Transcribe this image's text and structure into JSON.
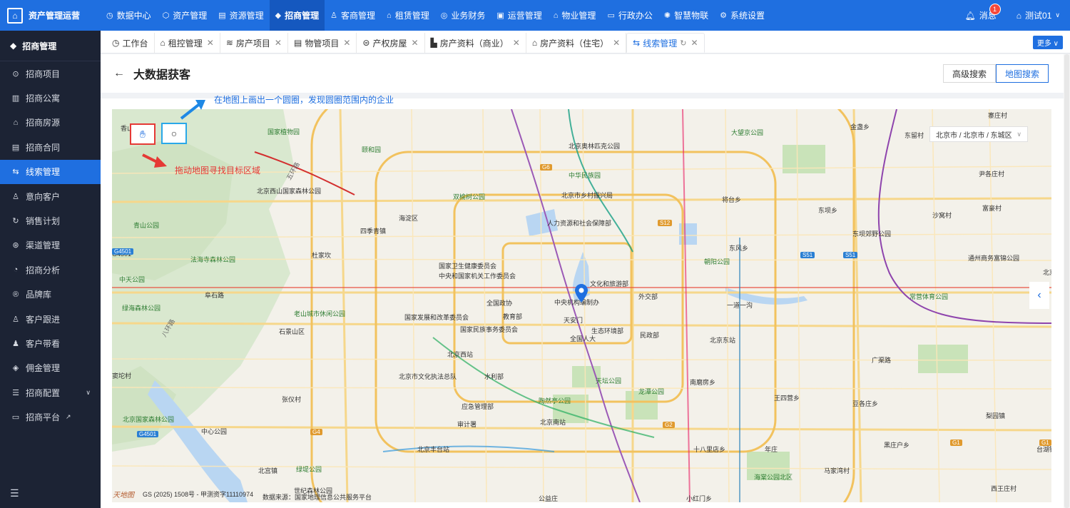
{
  "app": {
    "title": "资产管理运营"
  },
  "topnav": [
    {
      "label": "数据中心",
      "icon": "dashboard-icon",
      "glyph": "◷"
    },
    {
      "label": "资产管理",
      "icon": "cube-icon",
      "glyph": "⬡"
    },
    {
      "label": "资源管理",
      "icon": "building-icon",
      "glyph": "▤"
    },
    {
      "label": "招商管理",
      "icon": "diamond-icon",
      "glyph": "◆"
    },
    {
      "label": "客商管理",
      "icon": "user-group-icon",
      "glyph": "♙"
    },
    {
      "label": "租赁管理",
      "icon": "house-icon",
      "glyph": "⌂"
    },
    {
      "label": "业务财务",
      "icon": "coin-icon",
      "glyph": "◎"
    },
    {
      "label": "运营管理",
      "icon": "chart-icon",
      "glyph": "▣"
    },
    {
      "label": "物业管理",
      "icon": "home-icon",
      "glyph": "⌂"
    },
    {
      "label": "行政办公",
      "icon": "desktop-icon",
      "glyph": "▭"
    },
    {
      "label": "智慧物联",
      "icon": "iot-icon",
      "glyph": "✺"
    },
    {
      "label": "系统设置",
      "icon": "gear-icon",
      "glyph": "⚙"
    }
  ],
  "topright": {
    "messages_label": "消息",
    "messages_count": "1",
    "user_label": "测试01"
  },
  "sidebar": {
    "header": "招商管理",
    "items": [
      {
        "label": "招商项目",
        "glyph": "⊙"
      },
      {
        "label": "招商公寓",
        "glyph": "▥"
      },
      {
        "label": "招商房源",
        "glyph": "⌂"
      },
      {
        "label": "招商合同",
        "glyph": "▤"
      },
      {
        "label": "线索管理",
        "glyph": "⇆"
      },
      {
        "label": "意向客户",
        "glyph": "♙"
      },
      {
        "label": "销售计划",
        "glyph": "↻"
      },
      {
        "label": "渠道管理",
        "glyph": "⊛"
      },
      {
        "label": "招商分析",
        "glyph": "◔"
      },
      {
        "label": "品牌库",
        "glyph": "®"
      },
      {
        "label": "客户跟进",
        "glyph": "♙"
      },
      {
        "label": "客户带看",
        "glyph": "♟"
      },
      {
        "label": "佣金管理",
        "glyph": "◈"
      },
      {
        "label": "招商配置",
        "glyph": "☰"
      },
      {
        "label": "招商平台",
        "glyph": "▭"
      }
    ]
  },
  "tabs": [
    {
      "label": "工作台",
      "glyph": "◷"
    },
    {
      "label": "租控管理",
      "glyph": "⌂"
    },
    {
      "label": "房产项目",
      "glyph": "≋"
    },
    {
      "label": "物管项目",
      "glyph": "▤"
    },
    {
      "label": "产权房屋",
      "glyph": "⊜"
    },
    {
      "label": "房产资料（商业）",
      "glyph": "▙"
    },
    {
      "label": "房产资料（住宅）",
      "glyph": "⌂"
    },
    {
      "label": "线索管理",
      "glyph": "⇆"
    }
  ],
  "more_label": "更多",
  "page": {
    "title": "大数据获客",
    "advanced_search": "高级搜索",
    "map_search": "地图搜索",
    "circle_hint": "在地图上画出一个圆圈，发现圆圈范围内的企业",
    "drag_hint": "拖动地图寻找目标区域"
  },
  "map": {
    "region_label": "东留村",
    "region_value": "北京市 / 北京市 / 东城区",
    "attribution": "GS (2025) 1508号 - 甲测资字11110974",
    "data_source": "数据来源：国家地理信息公共服务平台",
    "stamp": "天地图",
    "labels": {
      "l1": "国家植物园",
      "l2": "香山公园",
      "l3": "北京西山国家森林公园",
      "l4": "颐和园",
      "l5": "北京奥林匹克公园",
      "l6": "中华民族园",
      "l7": "双榆树公园",
      "l8": "北京市乡村振兴局",
      "l9": "人力资源和社会保障部",
      "l10": "四季青镇",
      "l11": "海淀区",
      "l12": "杜家坎",
      "l13": "国家卫生健康委员会",
      "l14": "中央和国家机关工作委员会",
      "l15": "文化和旅游部",
      "l16": "全国政协",
      "l17": "中央机构编制办",
      "l18": "外交部",
      "l19": "国家发展和改革委员会",
      "l20": "教育部",
      "l21": "天安门",
      "l22": "国家民族事务委员会",
      "l23": "生态环境部",
      "l24": "民政部",
      "l25": "全国人大",
      "l26": "北京东站",
      "l27": "北京西站",
      "l28": "北京市文化执法总队",
      "l29": "水利部",
      "l30": "天坛公园",
      "l31": "龙潭公园",
      "l32": "陶然亭公园",
      "l33": "应急管理部",
      "l34": "审计署",
      "l35": "北京南站",
      "l36": "北京丰台站",
      "l37": "青山公园",
      "l38": "法海寺森林公园",
      "l39": "中天公园",
      "l40": "阜石路",
      "l41": "石景山区",
      "l42": "老山城市休闲公园",
      "l43": "绿海森林公园",
      "l44": "北京国家森林公园",
      "l45": "中心公园",
      "l46": "张仪村",
      "l47": "北宫镇",
      "l48": "绿堤公园",
      "l49": "世纪森林公园",
      "l50": "大望京公园",
      "l51": "金盏乡",
      "l52": "将台乡",
      "l53": "东坝乡",
      "l54": "朝阳公园",
      "l55": "东风乡",
      "l56": "东坝郊野公园",
      "l57": "沙窝村",
      "l58": "富豪村",
      "l59": "尹各庄村",
      "l60": "常营体育公园",
      "l61": "通州商务富锦公园",
      "l62": "南磨房乡",
      "l63": "王四营乡",
      "l64": "豆各庄乡",
      "l65": "十八里店乡",
      "l66": "年庄",
      "l67": "黑庄户乡",
      "l68": "马家湾村",
      "l69": "海棠公园北区",
      "l70": "小红门乡",
      "l71": "公益庄",
      "l72": "梨园镇",
      "l73": "广渠路",
      "l74": "北京市",
      "l75": "寨庄村",
      "l76": "一道一沟",
      "l77": "台湖镇",
      "l78": "G4501",
      "l79": "窦坨村",
      "l80": "西王庄村"
    },
    "roads": {
      "r1": "G6",
      "r2": "S12",
      "r3": "S51",
      "r4": "S51",
      "r5": "G4",
      "r6": "G2",
      "r7": "G1",
      "r8": "G1",
      "r9": "G4501",
      "r10": "G4501",
      "r11": "五环路",
      "r12": "八环路"
    }
  }
}
